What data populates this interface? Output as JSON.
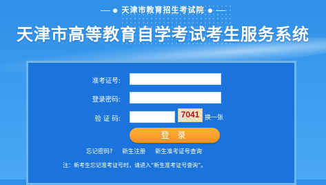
{
  "header": {
    "institution": "天津市教育招生考试院",
    "title": "天津市高等教育自学考试考生服务系统"
  },
  "form": {
    "exam_id_label": "准考证号:",
    "exam_id_value": "",
    "password_label": "登录密码:",
    "password_value": "",
    "captcha_label": "验 证 码:",
    "captcha_value": "",
    "captcha_text": "7041",
    "refresh_label": "换一张",
    "login_label": "登 录"
  },
  "links": {
    "forgot_password": "忘记密码?",
    "new_register": "新生注册",
    "new_exam_id_query": "新生准考证号查询"
  },
  "note": "注：新考生忘记准考证号时，请进入“新生准考证号查询”。"
}
